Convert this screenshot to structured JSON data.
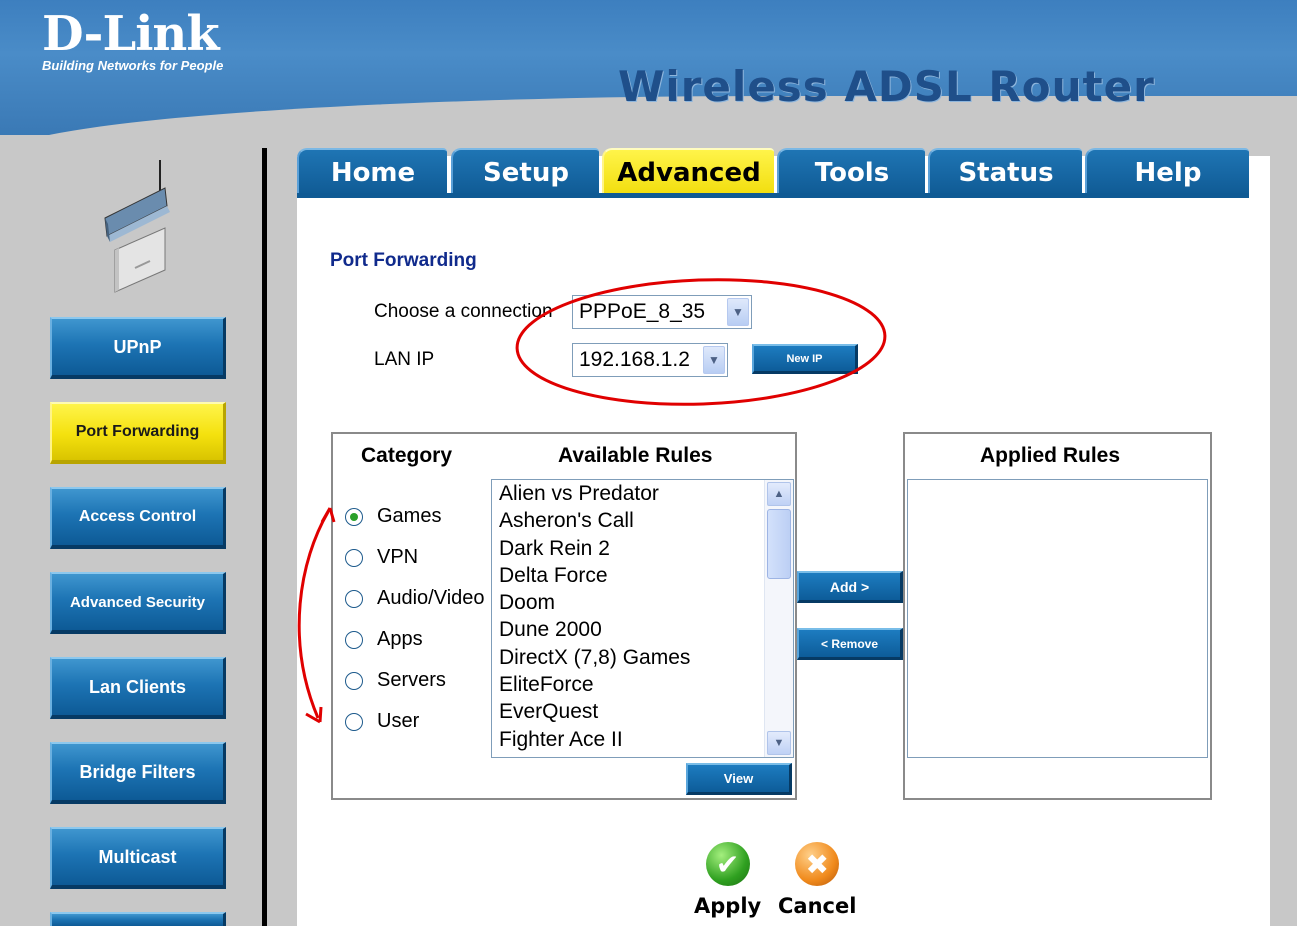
{
  "header": {
    "brand": "D-Link",
    "tagline": "Building Networks for People",
    "product_title": "Wireless ADSL Router"
  },
  "tabs": [
    {
      "label": "Home",
      "active": false
    },
    {
      "label": "Setup",
      "active": false
    },
    {
      "label": "Advanced",
      "active": true
    },
    {
      "label": "Tools",
      "active": false
    },
    {
      "label": "Status",
      "active": false
    },
    {
      "label": "Help",
      "active": false
    }
  ],
  "sidebar": {
    "items": [
      {
        "label": "UPnP",
        "active": false
      },
      {
        "label": "Port Forwarding",
        "active": true
      },
      {
        "label": "Access Control",
        "active": false
      },
      {
        "label": "Advanced Security",
        "active": false
      },
      {
        "label": "Lan Clients",
        "active": false
      },
      {
        "label": "Bridge Filters",
        "active": false
      },
      {
        "label": "Multicast",
        "active": false
      }
    ]
  },
  "page": {
    "section_title": "Port Forwarding",
    "connection_label": "Choose a connection",
    "connection_value": "PPPoE_8_35",
    "lan_ip_label": "LAN IP",
    "lan_ip_value": "192.168.1.2",
    "new_ip_button": "New IP"
  },
  "rules": {
    "category_header": "Category",
    "available_header": "Available Rules",
    "applied_header": "Applied Rules",
    "categories": [
      {
        "label": "Games",
        "selected": true
      },
      {
        "label": "VPN",
        "selected": false
      },
      {
        "label": "Audio/Video",
        "selected": false
      },
      {
        "label": "Apps",
        "selected": false
      },
      {
        "label": "Servers",
        "selected": false
      },
      {
        "label": "User",
        "selected": false
      }
    ],
    "available": [
      "Alien vs Predator",
      "Asheron's Call",
      "Dark Rein 2",
      "Delta Force",
      "Doom",
      "Dune 2000",
      "DirectX (7,8) Games",
      "EliteForce",
      "EverQuest",
      "Fighter Ace II"
    ],
    "applied": [],
    "add_button": "Add >",
    "remove_button": "< Remove",
    "view_button": "View"
  },
  "actions": {
    "apply": "Apply",
    "cancel": "Cancel"
  },
  "colors": {
    "header_blue": "#3d7fbf",
    "button_blue": "#0d5c99",
    "active_yellow": "#f4e10e",
    "title_navy": "#102a8c",
    "annotation_red": "#e00000"
  }
}
